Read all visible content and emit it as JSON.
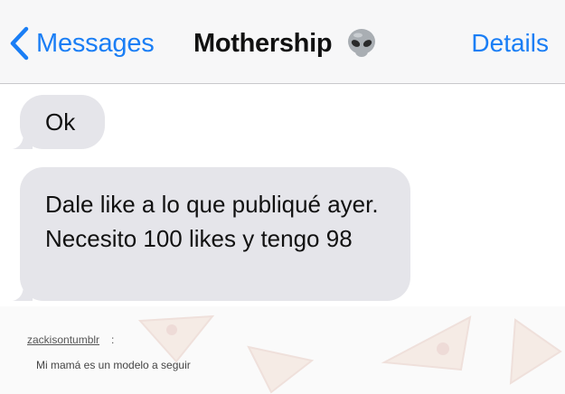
{
  "nav": {
    "back_label": "Messages",
    "title": "Mothership",
    "title_emoji": "alien-emoji",
    "details_label": "Details",
    "accent_color": "#1a7ef5"
  },
  "messages": [
    {
      "text": "Ok"
    },
    {
      "text": "Dale like a lo que publiqué ayer. Necesito 100 likes y tengo 98"
    }
  ],
  "bubble_color": "#e5e5ea",
  "caption": {
    "username": "zackisontumblr",
    "separator": ":",
    "quote": "Mi mamá es un modelo a seguir"
  }
}
